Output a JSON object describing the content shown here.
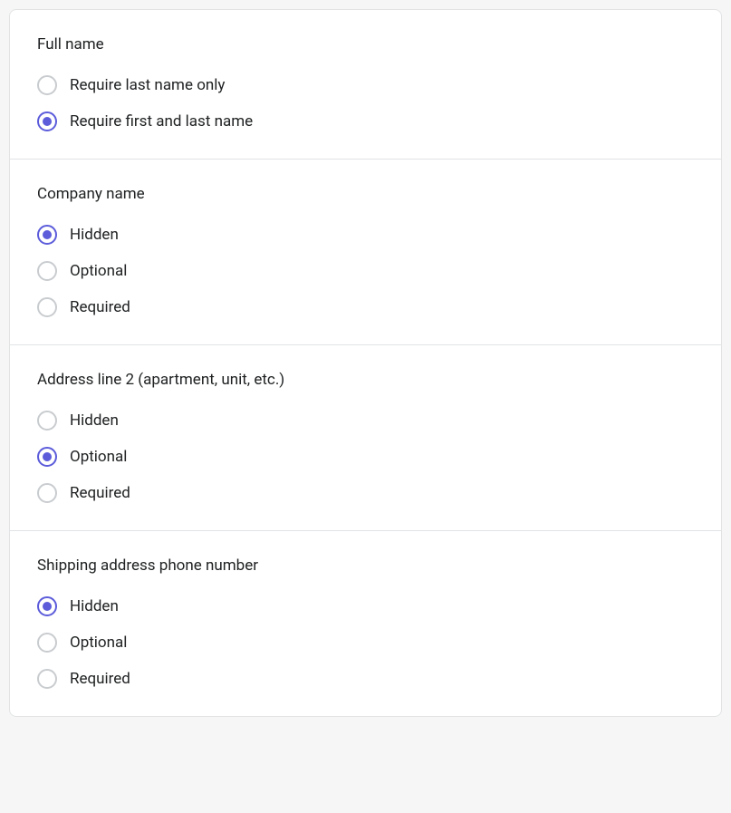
{
  "sections": {
    "fullName": {
      "title": "Full name",
      "options": {
        "lastOnly": "Require last name only",
        "firstAndLast": "Require first and last name"
      },
      "selected": "firstAndLast"
    },
    "companyName": {
      "title": "Company name",
      "options": {
        "hidden": "Hidden",
        "optional": "Optional",
        "required": "Required"
      },
      "selected": "hidden"
    },
    "addressLine2": {
      "title": "Address line 2 (apartment, unit, etc.)",
      "options": {
        "hidden": "Hidden",
        "optional": "Optional",
        "required": "Required"
      },
      "selected": "optional"
    },
    "shippingPhone": {
      "title": "Shipping address phone number",
      "options": {
        "hidden": "Hidden",
        "optional": "Optional",
        "required": "Required"
      },
      "selected": "hidden"
    }
  }
}
